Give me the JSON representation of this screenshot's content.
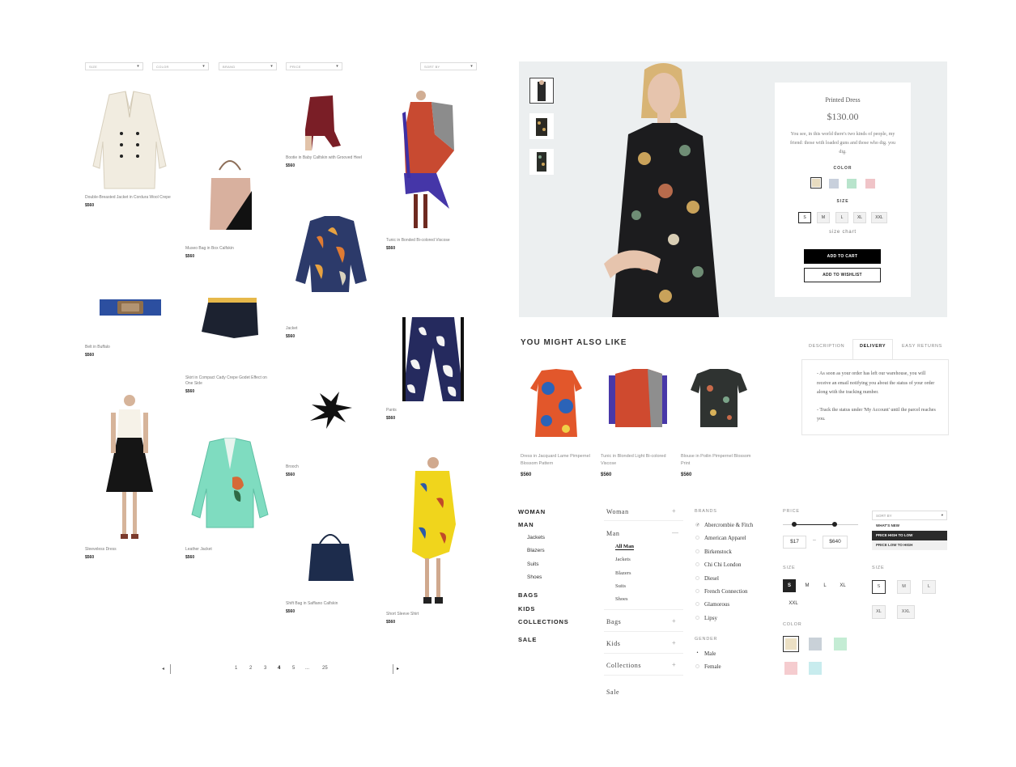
{
  "filters": {
    "size": "SIZE",
    "color": "COLOR",
    "brand": "BRAND",
    "price": "PRICE",
    "sort": "SORT BY"
  },
  "products": [
    {
      "name": "Double-Breasted Jacket in Cordura Wool Crepe",
      "price": "$560"
    },
    {
      "name": "Museo Bag in Box Calfskin",
      "price": "$560"
    },
    {
      "name": "Bootie in Baby Calfskin with Grooved Heel",
      "price": "$560"
    },
    {
      "name": "Tunic in Bonded Bi-colored Viscose",
      "price": "$560"
    },
    {
      "name": "Belt in Buffalo",
      "price": "$560"
    },
    {
      "name": "Skirt in Compact Cady Crepe Godet Effect on One Side",
      "price": "$560"
    },
    {
      "name": "Jacket",
      "price": "$560"
    },
    {
      "name": "Pants",
      "price": "$560"
    },
    {
      "name": "Sleeveless Dress",
      "price": "$560"
    },
    {
      "name": "Leather Jacket",
      "price": "$560"
    },
    {
      "name": "Brooch",
      "price": "$560"
    },
    {
      "name": "Short Sleeve Shirt",
      "price": "$560"
    },
    {
      "name": "Shift Bag in Saffiano Calfskin",
      "price": "$560"
    }
  ],
  "pagination": {
    "pages": [
      "1",
      "2",
      "3",
      "4",
      "5",
      "...",
      "25"
    ],
    "current": "4",
    "prev": "◂",
    "next": "▸"
  },
  "detail": {
    "title": "Printed Dress",
    "price": "$130.00",
    "description": "You see, in this world there's two kinds of people, my friend: those with loaded guns and those who dig. you dig.",
    "color_label": "COLOR",
    "colors": [
      "#e8dcc0",
      "#c8d0dc",
      "#b8e4cc",
      "#f0c4c8"
    ],
    "size_label": "SIZE",
    "sizes": [
      "S",
      "M",
      "L",
      "XL",
      "XXL"
    ],
    "selected_size": "S",
    "size_chart": "size chart",
    "add_to_cart": "ADD TO CART",
    "add_to_wishlist": "ADD TO WISHLIST"
  },
  "related": {
    "title": "YOU MIGHT ALSO LIKE",
    "items": [
      {
        "name": "Dress in Jacquard Lame Pimpernel Blossom Pattern",
        "price": "$560"
      },
      {
        "name": "Tunic in Blonded Light Bi-colored Viscose",
        "price": "$560"
      },
      {
        "name": "Blouse in Poilin Pimpernel Blossom Print",
        "price": "$560"
      }
    ]
  },
  "tabs": {
    "items": [
      "DESCRIPTION",
      "DELIVERY",
      "EASY RETURNS"
    ],
    "active": "DELIVERY",
    "delivery_p1": "- As soon as your order has left our warehouse, you will receive an email notifying you about the status of your order along with the tracking number.",
    "delivery_p2": "- Track the status under 'My Account' until the parcel reaches you."
  },
  "nav1": {
    "woman": "WOMAN",
    "man": "MAN",
    "man_items": [
      "Jackets",
      "Blazers",
      "Suits",
      "Shoes"
    ],
    "bags": "BAGS",
    "kids": "KIDS",
    "collections": "COLLECTIONS",
    "sale": "SALE"
  },
  "nav2": {
    "woman": "Woman",
    "man": "Man",
    "man_items": [
      "All Man",
      "Jackets",
      "Blazers",
      "Suits",
      "Shoes"
    ],
    "bags": "Bags",
    "kids": "Kids",
    "collections": "Collections",
    "sale": "Sale",
    "plus": "+",
    "minus": "—"
  },
  "brands": {
    "label": "BRANDS",
    "items": [
      "Abercrombie & Fitch",
      "American Apparel",
      "Birkenstock",
      "Chi Chi London",
      "Diesel",
      "French Connection",
      "Glamorous",
      "Lipsy"
    ]
  },
  "gender": {
    "label": "GENDER",
    "items": [
      "Male",
      "Female"
    ]
  },
  "price_filter": {
    "label": "PRICE",
    "min": "$17",
    "max": "$640",
    "dash": "–"
  },
  "size_filter_a": {
    "label": "SIZE",
    "items": [
      "S",
      "M",
      "L",
      "XL",
      "XXL"
    ]
  },
  "color_filter": {
    "label": "COLOR",
    "colors": [
      "#ece0c4",
      "#c9d1d8",
      "#c4ecd4",
      "#f5cccf",
      "#c8ecee"
    ]
  },
  "sort_dropdown": {
    "label": "SORT BY",
    "options": [
      "WHAT'S NEW",
      "PRICE HIGH TO LOW",
      "PRICE LOW TO HIGH"
    ],
    "selected": "PRICE HIGH TO LOW"
  },
  "size_filter_b": {
    "label": "SIZE",
    "items": [
      "S",
      "M",
      "L",
      "XL",
      "XXL"
    ]
  }
}
